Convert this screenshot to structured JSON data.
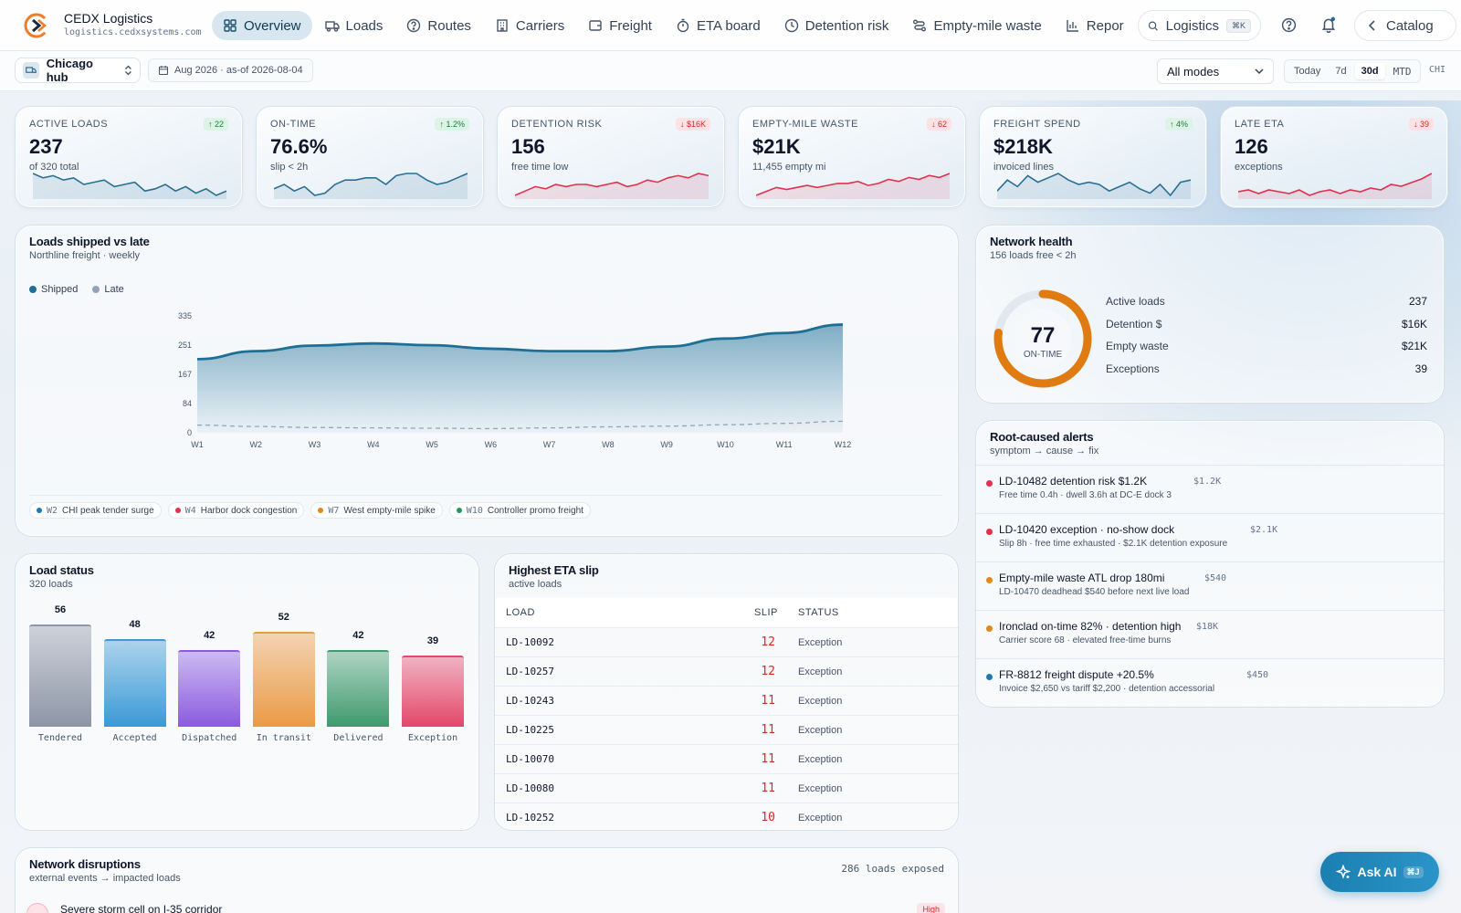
{
  "app": {
    "name": "CEDX Logistics",
    "domain": "logistics.cedxsystems.com"
  },
  "nav": [
    {
      "label": "Overview",
      "icon": "grid-icon",
      "active": true
    },
    {
      "label": "Loads",
      "icon": "truck-icon"
    },
    {
      "label": "Routes",
      "icon": "help-circle-icon"
    },
    {
      "label": "Carriers",
      "icon": "building-icon"
    },
    {
      "label": "Freight",
      "icon": "wallet-icon"
    },
    {
      "label": "ETA board",
      "icon": "stopwatch-icon"
    },
    {
      "label": "Detention risk",
      "icon": "clock-icon"
    },
    {
      "label": "Empty-mile waste",
      "icon": "route-icon"
    },
    {
      "label": "Repor",
      "icon": "bar-chart-icon"
    }
  ],
  "search": {
    "label": "Logistics",
    "shortcut": "⌘K"
  },
  "catalog": {
    "label": "Catalog"
  },
  "filters": {
    "hub": "Chicago hub",
    "date": "Aug 2026 · as-of 2026-08-04",
    "mode": "All modes",
    "ranges": [
      "Today",
      "7d",
      "30d",
      "MTD"
    ],
    "active_range": "30d",
    "region": "CHI"
  },
  "kpis": [
    {
      "label": "ACTIVE LOADS",
      "value": "237",
      "sub": "of 320 total",
      "delta": "↑ 22",
      "dir": "up",
      "color": "#2a6f93",
      "spark": [
        14,
        12,
        13,
        11,
        12,
        9,
        10,
        11,
        8,
        9,
        10,
        6,
        7,
        9,
        6,
        8,
        5,
        7,
        4,
        6
      ]
    },
    {
      "label": "ON-TIME",
      "value": "76.6%",
      "sub": "slip < 2h",
      "delta": "↑ 1.2%",
      "dir": "up",
      "color": "#2a6f93",
      "spark": [
        6,
        8,
        5,
        7,
        3,
        4,
        8,
        10,
        10,
        11,
        11,
        8,
        12,
        13,
        13,
        10,
        8,
        9,
        11,
        13
      ]
    },
    {
      "label": "DETENTION RISK",
      "value": "156",
      "sub": "free time low",
      "delta": "↓ $16K",
      "dir": "down",
      "color": "#e0324f",
      "spark": [
        2,
        4,
        6,
        5,
        7,
        6,
        7,
        7,
        6,
        7,
        8,
        6,
        7,
        9,
        8,
        10,
        11,
        10,
        12,
        11
      ]
    },
    {
      "label": "EMPTY-MILE WASTE",
      "value": "$21K",
      "sub": "11,455 empty mi",
      "delta": "↓ 62",
      "dir": "down",
      "color": "#e0324f",
      "spark": [
        2,
        4,
        6,
        5,
        6,
        7,
        6,
        7,
        8,
        8,
        9,
        7,
        8,
        10,
        9,
        11,
        10,
        12,
        11,
        13
      ]
    },
    {
      "label": "FREIGHT SPEND",
      "value": "$218K",
      "sub": "invoiced lines",
      "delta": "↑ 4%",
      "dir": "up",
      "color": "#2a6f93",
      "spark": [
        5,
        10,
        7,
        12,
        9,
        11,
        13,
        10,
        8,
        9,
        8,
        5,
        7,
        9,
        6,
        4,
        8,
        3,
        9,
        10
      ]
    },
    {
      "label": "LATE ETA",
      "value": "126",
      "sub": "exceptions",
      "delta": "↓ 39",
      "dir": "down",
      "color": "#e0324f",
      "spark": [
        4,
        5,
        3,
        5,
        4,
        3,
        5,
        2,
        4,
        5,
        3,
        5,
        4,
        6,
        5,
        8,
        7,
        9,
        11,
        14
      ]
    }
  ],
  "loads_chart": {
    "title": "Loads shipped vs late",
    "subtitle": "Northline freight · weekly",
    "tags": [
      {
        "week": "W2",
        "text": "CHI peak tender surge",
        "color": "#1f78b4"
      },
      {
        "week": "W4",
        "text": "Harbor dock congestion",
        "color": "#e0324f"
      },
      {
        "week": "W7",
        "text": "West empty-mile spike",
        "color": "#e08a1e"
      },
      {
        "week": "W10",
        "text": "Controller promo freight",
        "color": "#1f9a5a"
      }
    ]
  },
  "chart_data": [
    {
      "type": "area",
      "title": "Loads shipped vs late",
      "subtitle": "Northline freight · weekly",
      "categories": [
        "W1",
        "W2",
        "W3",
        "W4",
        "W5",
        "W6",
        "W7",
        "W8",
        "W9",
        "W10",
        "W11",
        "W12"
      ],
      "yticks": [
        0,
        84,
        167,
        251,
        335
      ],
      "ylim": [
        0,
        335
      ],
      "legend": "top-left",
      "series": [
        {
          "name": "Shipped",
          "color": "#1d6f96",
          "values": [
            211,
            234,
            250,
            256,
            251,
            241,
            234,
            234,
            247,
            270,
            286,
            310
          ]
        },
        {
          "name": "Late",
          "color": "#94a3b8",
          "values": [
            22,
            18,
            15,
            14,
            13,
            12,
            14,
            17,
            19,
            23,
            27,
            33
          ]
        }
      ]
    },
    {
      "type": "bar",
      "title": "Load status",
      "subtitle": "320 loads",
      "categories": [
        "Tendered",
        "Accepted",
        "Dispatched",
        "In transit",
        "Delivered",
        "Exception"
      ],
      "values": [
        56,
        48,
        42,
        52,
        42,
        39
      ],
      "colors": [
        "#8e96a6",
        "#3a9ad6",
        "#8a5be0",
        "#eb9a45",
        "#3f9a6d",
        "#e4476a"
      ]
    }
  ],
  "health": {
    "title": "Network health",
    "subtitle": "156 loads free < 2h",
    "score": "77",
    "score_pct": 0.77,
    "score_label": "ON-TIME",
    "rows": [
      {
        "label": "Active loads",
        "value": "237"
      },
      {
        "label": "Detention $",
        "value": "$16K"
      },
      {
        "label": "Empty waste",
        "value": "$21K"
      },
      {
        "label": "Exceptions",
        "value": "39"
      }
    ]
  },
  "alerts": {
    "title": "Root-caused alerts",
    "subtitle": "symptom → cause → fix",
    "items": [
      {
        "title": "LD-10482 detention risk $1.2K",
        "amount": "$1.2K",
        "sub": "Free time 0.4h · dwell 3.6h at DC-E dock 3",
        "color": "#e0324f"
      },
      {
        "title": "LD-10420 exception · no-show dock",
        "amount": "$2.1K",
        "sub": "Slip 8h · free time exhausted · $2.1K detention exposure",
        "color": "#e0324f"
      },
      {
        "title": "Empty-mile waste ATL drop 180mi",
        "amount": "$540",
        "sub": "LD-10470 deadhead $540 before next live load",
        "color": "#e08a1e"
      },
      {
        "title": "Ironclad on-time 82% · detention high",
        "amount": "$18K",
        "sub": "Carrier score 68 · elevated free-time burns",
        "color": "#e08a1e"
      },
      {
        "title": "FR-8812 freight dispute +20.5%",
        "amount": "$450",
        "sub": "Invoice $2,650 vs tariff $2,200 · detention accessorial",
        "color": "#1f78b4"
      }
    ]
  },
  "load_status": {
    "title": "Load status",
    "subtitle": "320 loads"
  },
  "eta_slip": {
    "title": "Highest ETA slip",
    "subtitle": "active loads",
    "headers": [
      "LOAD",
      "SLIP",
      "STATUS"
    ],
    "rows": [
      {
        "load": "LD-10092",
        "slip": "12",
        "status": "Exception"
      },
      {
        "load": "LD-10257",
        "slip": "12",
        "status": "Exception"
      },
      {
        "load": "LD-10243",
        "slip": "11",
        "status": "Exception"
      },
      {
        "load": "LD-10225",
        "slip": "11",
        "status": "Exception"
      },
      {
        "load": "LD-10070",
        "slip": "11",
        "status": "Exception"
      },
      {
        "load": "LD-10080",
        "slip": "11",
        "status": "Exception"
      },
      {
        "load": "LD-10252",
        "slip": "10",
        "status": "Exception"
      }
    ]
  },
  "disruptions": {
    "title": "Network disruptions",
    "subtitle": "external events → impacted loads",
    "exposed": "286 loads exposed",
    "first": {
      "title": "Severe storm cell on I-35 corridor",
      "badge": "High"
    }
  },
  "ask_ai": {
    "label": "Ask AI",
    "shortcut": "⌘J"
  }
}
